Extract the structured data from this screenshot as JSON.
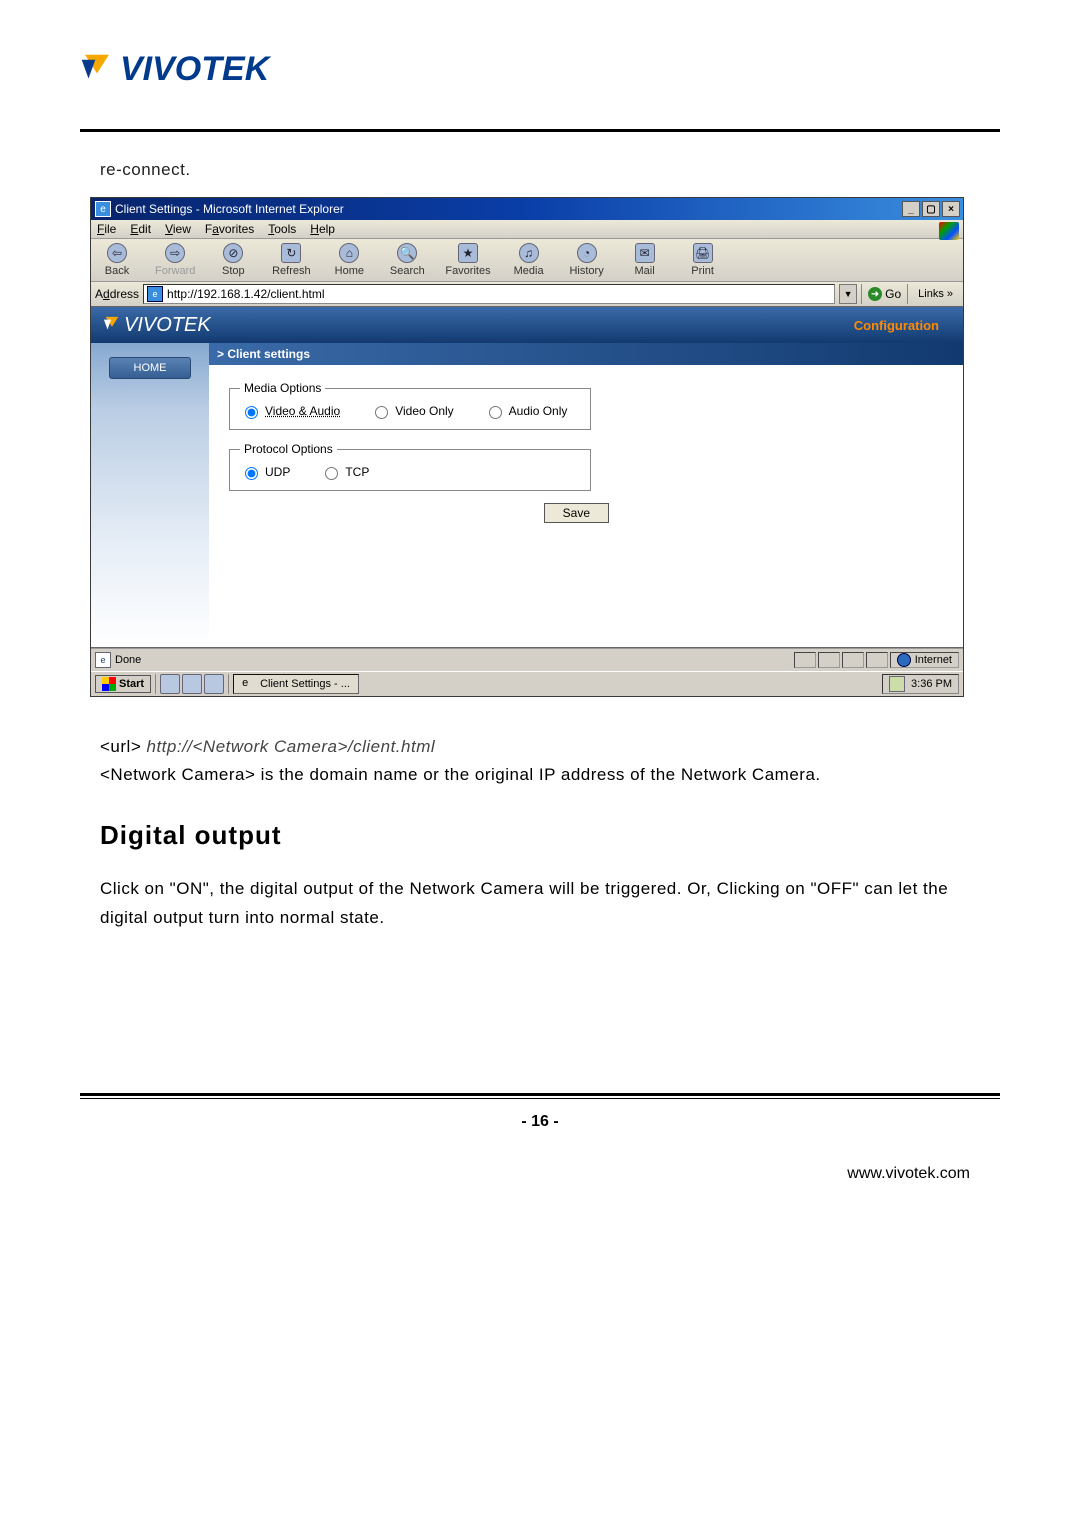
{
  "header_logo_text": "VIVOTEK",
  "reconnect_text": "re-connect.",
  "ie": {
    "title": "Client Settings - Microsoft Internet Explorer",
    "menus": {
      "file": "File",
      "edit": "Edit",
      "view": "View",
      "favorites": "Favorites",
      "tools": "Tools",
      "help": "Help"
    },
    "toolbar": {
      "back": "Back",
      "forward": "Forward",
      "stop": "Stop",
      "refresh": "Refresh",
      "home": "Home",
      "search": "Search",
      "favoritesBtn": "Favorites",
      "media": "Media",
      "history": "History",
      "mail": "Mail",
      "print": "Print"
    },
    "address_label": "Address",
    "address_value": "http://192.168.1.42/client.html",
    "go": "Go",
    "links": "Links »",
    "banner_logo": "VIVOTEK",
    "configuration": "Configuration",
    "home": "HOME",
    "client_settings": "> Client settings",
    "media_legend": "Media Options",
    "media": {
      "va": "Video & Audio",
      "vo": "Video Only",
      "ao": "Audio Only"
    },
    "protocol_legend": "Protocol Options",
    "protocol": {
      "udp": "UDP",
      "tcp": "TCP"
    },
    "save": "Save",
    "status_done": "Done",
    "status_internet": "Internet",
    "start": "Start",
    "task_item": "Client Settings - ...",
    "clock": "3:36 PM"
  },
  "url_line_prefix": "<url>  ",
  "url_line_italic": "http://<Network Camera>/client.html",
  "desc_line": "<Network Camera> is the domain name or the original IP address of the Network Camera.",
  "section_title": "Digital output",
  "paragraph": "Click on \"ON\", the digital output of the Network Camera will be triggered. Or, Clicking on \"OFF\" can let the digital output turn into normal state.",
  "page_number": "- 16 -",
  "site": "www.vivotek.com"
}
